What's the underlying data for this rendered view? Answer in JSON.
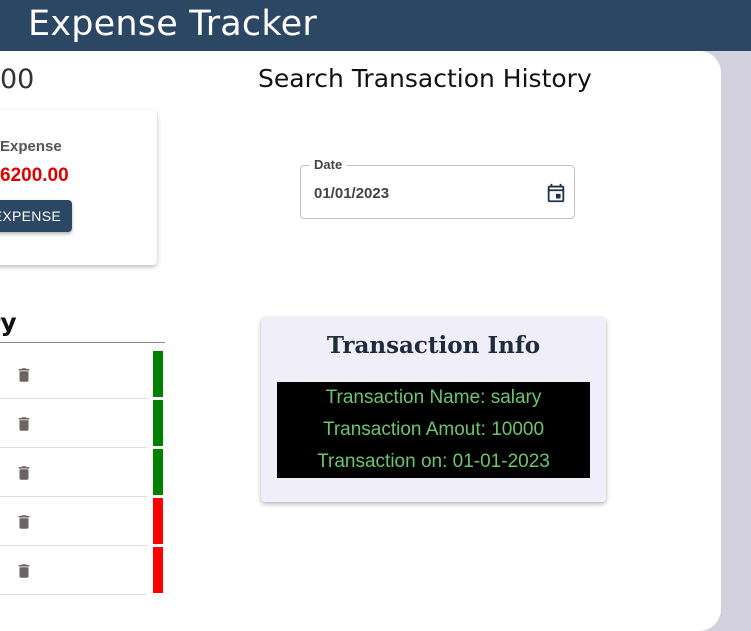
{
  "header": {
    "title": "Expense Tracker"
  },
  "summary": {
    "balance_fragment": "00",
    "expense_label": "Expense",
    "expense_value": "6200.00",
    "add_button_label": "D EXPENSE"
  },
  "history": {
    "heading_fragment": "ry",
    "rows": [
      {
        "status": "income",
        "color": "#008000"
      },
      {
        "status": "income",
        "color": "#008000"
      },
      {
        "status": "income",
        "color": "#008000"
      },
      {
        "status": "expense",
        "color": "#ff0000"
      },
      {
        "status": "expense",
        "color": "#ff0000"
      }
    ]
  },
  "search": {
    "title": "Search Transaction History",
    "date_label": "Date",
    "date_value": "01/01/2023"
  },
  "transaction_info": {
    "title": "Transaction Info",
    "name_line": "Transaction Name: salary",
    "amount_line": "Transaction Amout: 10000",
    "date_line": "Transaction on: 01-01-2023"
  },
  "colors": {
    "header_bg": "#2c4763",
    "income": "#008000",
    "expense": "#ff0000",
    "expense_text": "#e00000",
    "info_text": "#6cc56c"
  },
  "icons": {
    "trash": "trash-icon",
    "calendar": "calendar-icon"
  }
}
